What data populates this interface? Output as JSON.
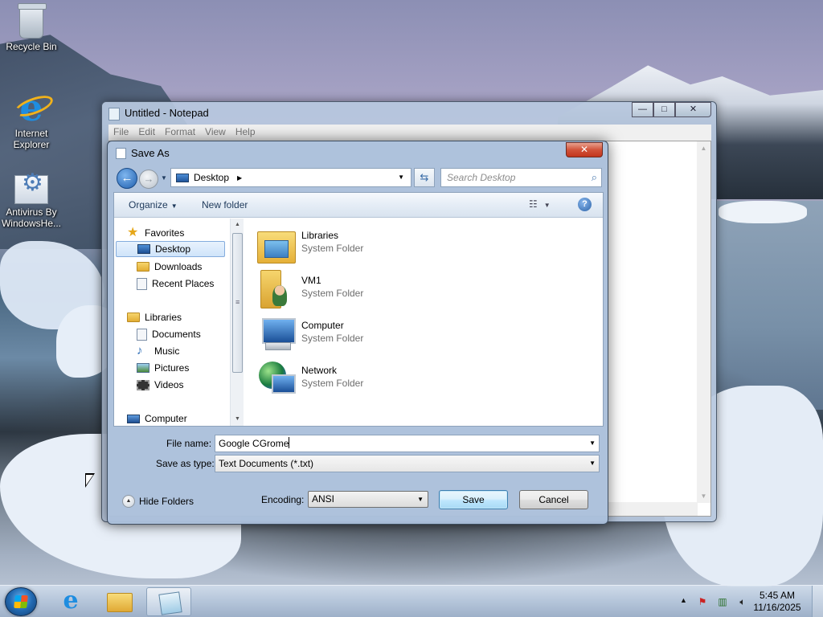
{
  "desktop": {
    "icons": [
      {
        "label": "Recycle Bin",
        "icon": "recycle-bin-icon"
      },
      {
        "label": "Internet Explorer",
        "icon": "internet-explorer-icon"
      },
      {
        "label": "Antivirus By WindowsHe...",
        "icon": "antivirus-icon"
      }
    ]
  },
  "notepad": {
    "title": "Untitled - Notepad",
    "controls": {
      "minimize": "—",
      "maximize": "□",
      "close": "✕"
    },
    "menu": [
      "File",
      "Edit",
      "Format",
      "View",
      "Help"
    ]
  },
  "dialog": {
    "title": "Save As",
    "close": "✕",
    "address": {
      "location": "Desktop"
    },
    "search_placeholder": "Search Desktop",
    "toolbar": {
      "organize": "Organize",
      "new_folder": "New folder",
      "help": "?"
    },
    "nav": {
      "favorites": "Favorites",
      "desktop": "Desktop",
      "downloads": "Downloads",
      "recent_places": "Recent Places",
      "libraries": "Libraries",
      "documents": "Documents",
      "music": "Music",
      "pictures": "Pictures",
      "videos": "Videos",
      "computer": "Computer"
    },
    "items": [
      {
        "name": "Libraries",
        "type": "System Folder",
        "icon": "libraries-icon"
      },
      {
        "name": "VM1",
        "type": "System Folder",
        "icon": "user-folder-icon"
      },
      {
        "name": "Computer",
        "type": "System Folder",
        "icon": "computer-icon"
      },
      {
        "name": "Network",
        "type": "System Folder",
        "icon": "network-icon"
      }
    ],
    "file_name_label": "File name:",
    "file_name_value": "Google CGrome",
    "save_as_type_label": "Save as type:",
    "save_as_type_value": "Text Documents (*.txt)",
    "hide_folders": "Hide Folders",
    "encoding_label": "Encoding:",
    "encoding_value": "ANSI",
    "save": "Save",
    "cancel": "Cancel"
  },
  "taskbar": {
    "clock_time": "5:45 AM",
    "clock_date": "11/16/2025"
  }
}
